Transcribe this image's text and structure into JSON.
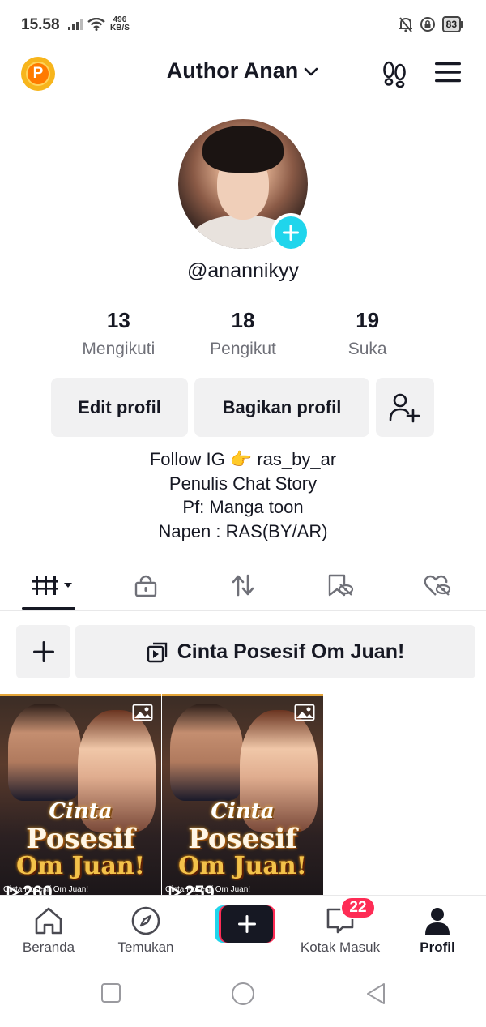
{
  "status_bar": {
    "time": "15.58",
    "net_speed_value": "496",
    "net_speed_unit": "KB/S",
    "battery": "83"
  },
  "header": {
    "account_name": "Author Anan",
    "coin_letter": "P"
  },
  "profile": {
    "username": "@anannikyy",
    "stats": [
      {
        "value": "13",
        "label": "Mengikuti"
      },
      {
        "value": "18",
        "label": "Pengikut"
      },
      {
        "value": "19",
        "label": "Suka"
      }
    ],
    "buttons": {
      "edit": "Edit profil",
      "share": "Bagikan profil"
    },
    "bio": [
      "Follow IG  👉 ras_by_ar",
      "Penulis Chat Story",
      "Pf: Manga toon",
      "Napen : RAS(BY/AR)"
    ]
  },
  "playlist": {
    "title": "Cinta Posesif Om Juan!"
  },
  "videos": [
    {
      "cover_line1": "Cinta",
      "cover_line2": "Posesif",
      "cover_line3": "Om Juan!",
      "caption": "Cinta Posesif Om Juan!",
      "views": "260"
    },
    {
      "cover_line1": "Cinta",
      "cover_line2": "Posesif",
      "cover_line3": "Om Juan!",
      "caption": "Cinta Posesif Om Juan!",
      "views": "259"
    }
  ],
  "bottom_nav": {
    "home": "Beranda",
    "discover": "Temukan",
    "inbox": "Kotak Masuk",
    "inbox_badge": "22",
    "profile": "Profil"
  },
  "colors": {
    "accent_cyan": "#20d5ec",
    "accent_red": "#fe2c55",
    "text_primary": "#161823",
    "text_secondary": "#6f7078",
    "button_bg": "#f1f1f2"
  }
}
